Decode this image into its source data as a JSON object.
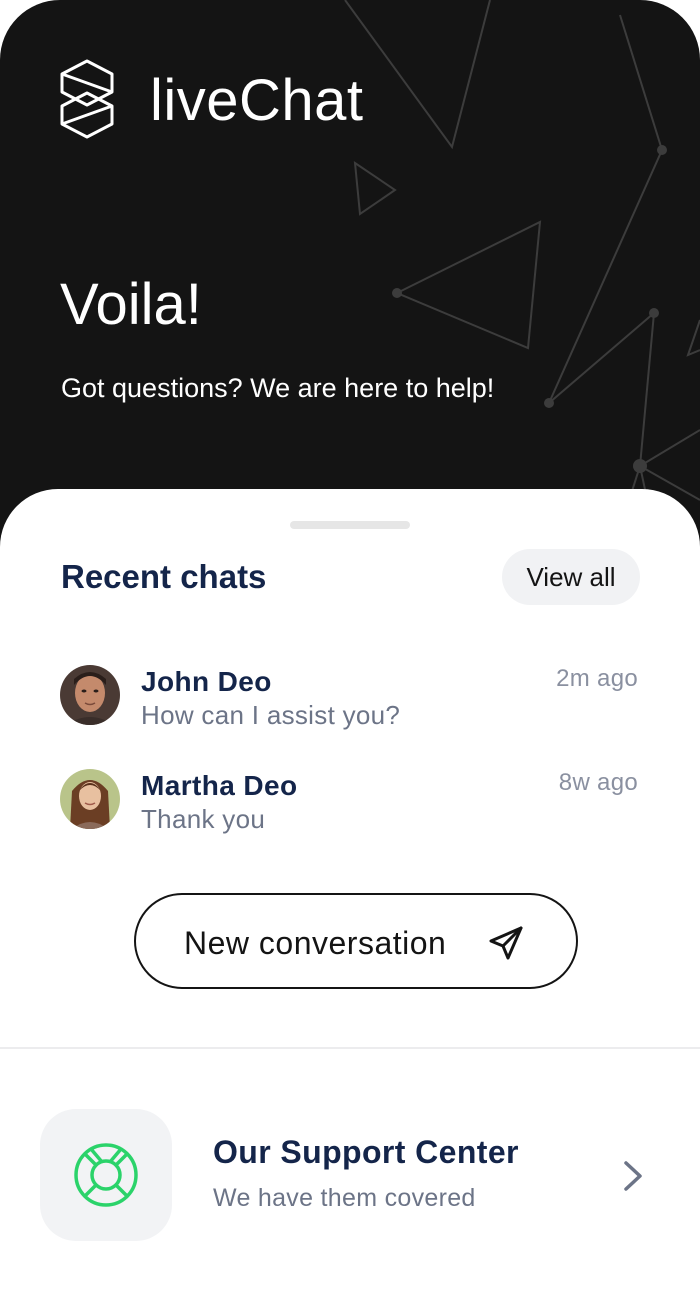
{
  "header": {
    "app_name": "liveChat",
    "greeting": "Voila!",
    "subtitle": "Got questions? We are here to help!",
    "background_color": "#141414"
  },
  "recent": {
    "title": "Recent chats",
    "view_all_label": "View all",
    "chats": [
      {
        "name": "John Deo",
        "message": "How can I assist you?",
        "time": "2m ago",
        "avatar": "male-avatar"
      },
      {
        "name": "Martha Deo",
        "message": "Thank you",
        "time": "8w ago",
        "avatar": "female-avatar"
      }
    ]
  },
  "new_conversation": {
    "label": "New conversation",
    "icon": "send-icon"
  },
  "support": {
    "title": "Our Support Center",
    "subtitle": "We have them covered",
    "icon": "lifebuoy-icon",
    "icon_color": "#2bd36a"
  },
  "colors": {
    "primary_text": "#14254a",
    "secondary_text": "#6c7487",
    "accent": "#2bd36a"
  }
}
